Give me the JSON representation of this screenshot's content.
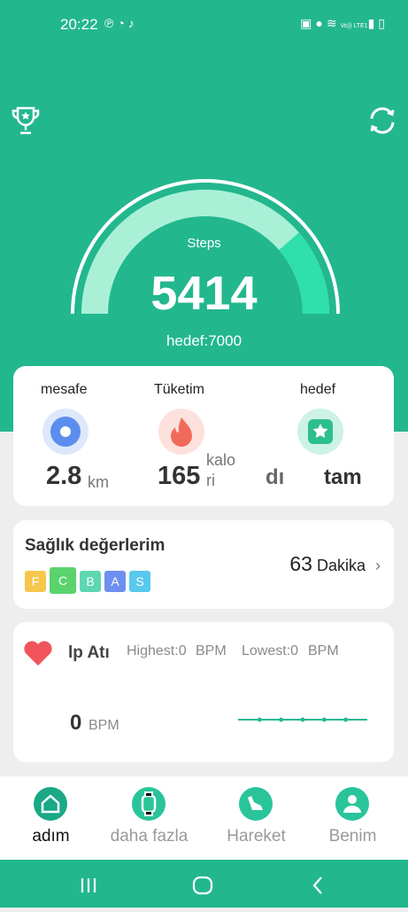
{
  "status_bar": {
    "time": "20:22",
    "left_icons": [
      "p-icon",
      "whatsapp-icon",
      "bell-icon"
    ],
    "right_icons": [
      "battery-saver-icon",
      "location-icon",
      "wifi-icon",
      "volte-icon",
      "signal-icon",
      "battery-icon"
    ],
    "volte_text": "Vo)) LTE1"
  },
  "header": {
    "trophy_icon": "trophy-icon",
    "refresh_icon": "refresh-icon"
  },
  "gauge": {
    "label": "Steps",
    "steps": 5414,
    "steps_text": "5414",
    "goal_text": "hedef:7000",
    "goal": 7000,
    "progress": 0.773
  },
  "stats": [
    {
      "title": "mesafe",
      "value": "2.8",
      "unit": "km",
      "icon": "location-pin-icon",
      "color": "#5b8def"
    },
    {
      "title": "Tüketim",
      "value": "165",
      "unit_line1": "kalo",
      "unit_line2": "ri",
      "icon": "flame-icon",
      "color": "#f06a5a"
    },
    {
      "title": "hedef",
      "value_left": "dı",
      "value_right": "tam",
      "icon": "star-badge-icon",
      "color": "#2dbf8e"
    }
  ],
  "health": {
    "title": "Sağlık değerlerim",
    "badges": [
      {
        "letter": "F",
        "color": "#f7c64c"
      },
      {
        "letter": "C",
        "color": "#5ad36d"
      },
      {
        "letter": "B",
        "color": "#5ed6b0"
      },
      {
        "letter": "A",
        "color": "#6d8ff0"
      },
      {
        "letter": "S",
        "color": "#58c9ec"
      }
    ],
    "minutes": "63",
    "minutes_label": "Dakika"
  },
  "heart": {
    "title": "lp Atı",
    "highest": "Highest:0",
    "highest_unit": "BPM",
    "lowest": "Lowest:0",
    "lowest_unit": "BPM",
    "value": "0",
    "unit": "BPM",
    "trend_values": [
      0,
      0,
      0,
      0,
      0,
      0,
      0
    ]
  },
  "bottom_nav": [
    {
      "label": "adım",
      "icon": "home-icon",
      "active": true
    },
    {
      "label": "daha fazla",
      "icon": "watch-icon",
      "active": false
    },
    {
      "label": "Hareket",
      "icon": "shoe-icon",
      "active": false
    },
    {
      "label": "Benim",
      "icon": "user-icon",
      "active": false
    }
  ],
  "colors": {
    "accent": "#23b78e",
    "gauge_fill": "#a9f0d7",
    "gauge_progress": "#2fe0ab"
  }
}
